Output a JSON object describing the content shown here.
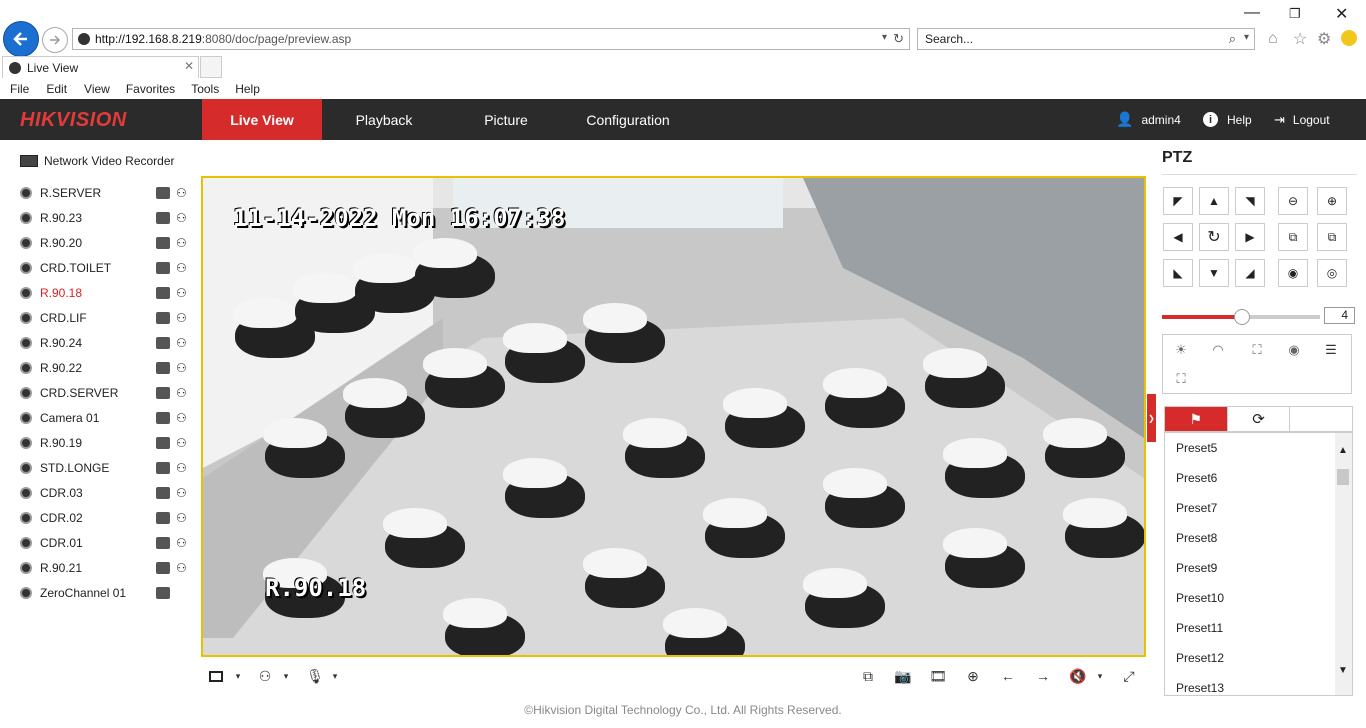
{
  "browser": {
    "url_host": "http://192.168.8.219",
    "url_rest": ":8080/doc/page/preview.asp",
    "search_placeholder": "Search...",
    "tab_title": "Live View",
    "menu": [
      "File",
      "Edit",
      "View",
      "Favorites",
      "Tools",
      "Help"
    ]
  },
  "app": {
    "logo": "HIKVISION",
    "nav": [
      "Live View",
      "Playback",
      "Picture",
      "Configuration"
    ],
    "user": "admin4",
    "help": "Help",
    "logout": "Logout"
  },
  "tree": {
    "root": "Network Video Recorder",
    "cameras": [
      "R.SERVER",
      "R.90.23",
      "R.90.20",
      "CRD.TOILET",
      "R.90.18",
      "CRD.LIF",
      "R.90.24",
      "R.90.22",
      "CRD.SERVER",
      "Camera 01",
      "R.90.19",
      "STD.LONGE",
      "CDR.03",
      "CDR.02",
      "CDR.01",
      "R.90.21",
      "ZeroChannel 01"
    ],
    "selected_index": 4
  },
  "video": {
    "timestamp": "11-14-2022 Mon 16:07:38",
    "channel_label": "R.90.18"
  },
  "ptz": {
    "title": "PTZ",
    "speed": "4",
    "speed_fraction": 0.5,
    "presets": [
      "Preset5",
      "Preset6",
      "Preset7",
      "Preset8",
      "Preset9",
      "Preset10",
      "Preset11",
      "Preset12",
      "Preset13"
    ]
  },
  "footer": "©Hikvision Digital Technology Co., Ltd. All Rights Reserved.",
  "colors": {
    "accent": "#d62b2b",
    "header_bg": "#2b2b2b",
    "video_border": "#e6c200"
  }
}
